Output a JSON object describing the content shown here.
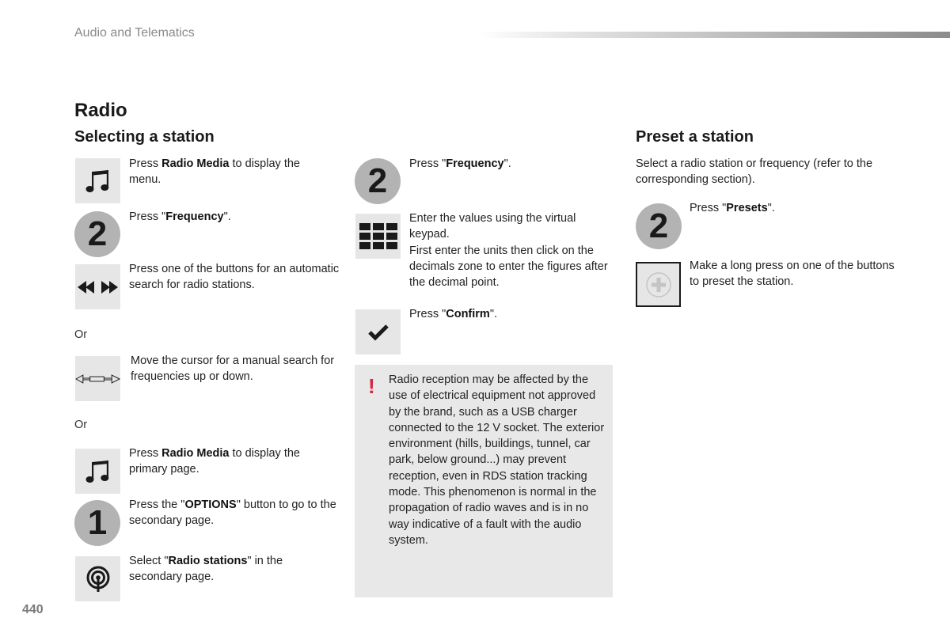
{
  "header": {
    "section_title": "Audio and Telematics"
  },
  "page_number": "440",
  "title": "Radio",
  "selecting": {
    "heading": "Selecting a station",
    "steps": [
      {
        "icon": "music-note-icon",
        "pre": "Press ",
        "bold": "Radio Media",
        "post": " to display the menu."
      },
      {
        "icon": "step-number",
        "number": "2",
        "pre": "Press \"",
        "bold": "Frequency",
        "post": "\"."
      },
      {
        "icon": "seek-buttons-icon",
        "text": "Press one of the buttons for an automatic search for radio stations."
      },
      {
        "or": "Or"
      },
      {
        "icon": "slider-cursor-icon",
        "text": "Move the cursor for a manual search for frequencies up or down."
      },
      {
        "or": "Or"
      },
      {
        "icon": "music-note-icon",
        "pre": "Press ",
        "bold": "Radio Media",
        "post": " to display the primary page."
      },
      {
        "icon": "step-number",
        "number": "1",
        "pre": "Press the \"",
        "bold": "OPTIONS",
        "post": "\" button to go to the secondary page."
      },
      {
        "icon": "radio-stations-icon",
        "pre": "Select \"",
        "bold": "Radio stations",
        "post": "\" in the secondary page."
      }
    ]
  },
  "frequency": {
    "steps": [
      {
        "icon": "step-number",
        "number": "2",
        "pre": "Press \"",
        "bold": "Frequency",
        "post": "\"."
      },
      {
        "icon": "keypad-icon",
        "line1": "Enter the values using the virtual keypad.",
        "line2": "First enter the units then click on the decimals zone to enter the figures after the decimal point."
      },
      {
        "icon": "checkmark-icon",
        "pre": "Press \"",
        "bold": "Confirm",
        "post": "\"."
      }
    ]
  },
  "warning": {
    "icon": "!",
    "text": "Radio reception may be affected by the use of electrical equipment not approved by the brand, such as a USB charger connected to the 12 V socket. The exterior environment (hills, buildings, tunnel, car park, below ground...) may prevent reception, even in RDS station tracking mode. This phenomenon is normal in the propagation of radio waves and is in no way indicative of a fault with the audio system.",
    "icon_color": "#d7263d"
  },
  "preset": {
    "heading": "Preset a station",
    "intro": "Select a radio station or frequency (refer to the corresponding section).",
    "steps": [
      {
        "icon": "step-number",
        "number": "2",
        "pre": "Press \"",
        "bold": "Presets",
        "post": "\"."
      },
      {
        "icon": "add-preset-icon",
        "text": "Make a long press on one of the buttons to preset the station."
      }
    ]
  }
}
